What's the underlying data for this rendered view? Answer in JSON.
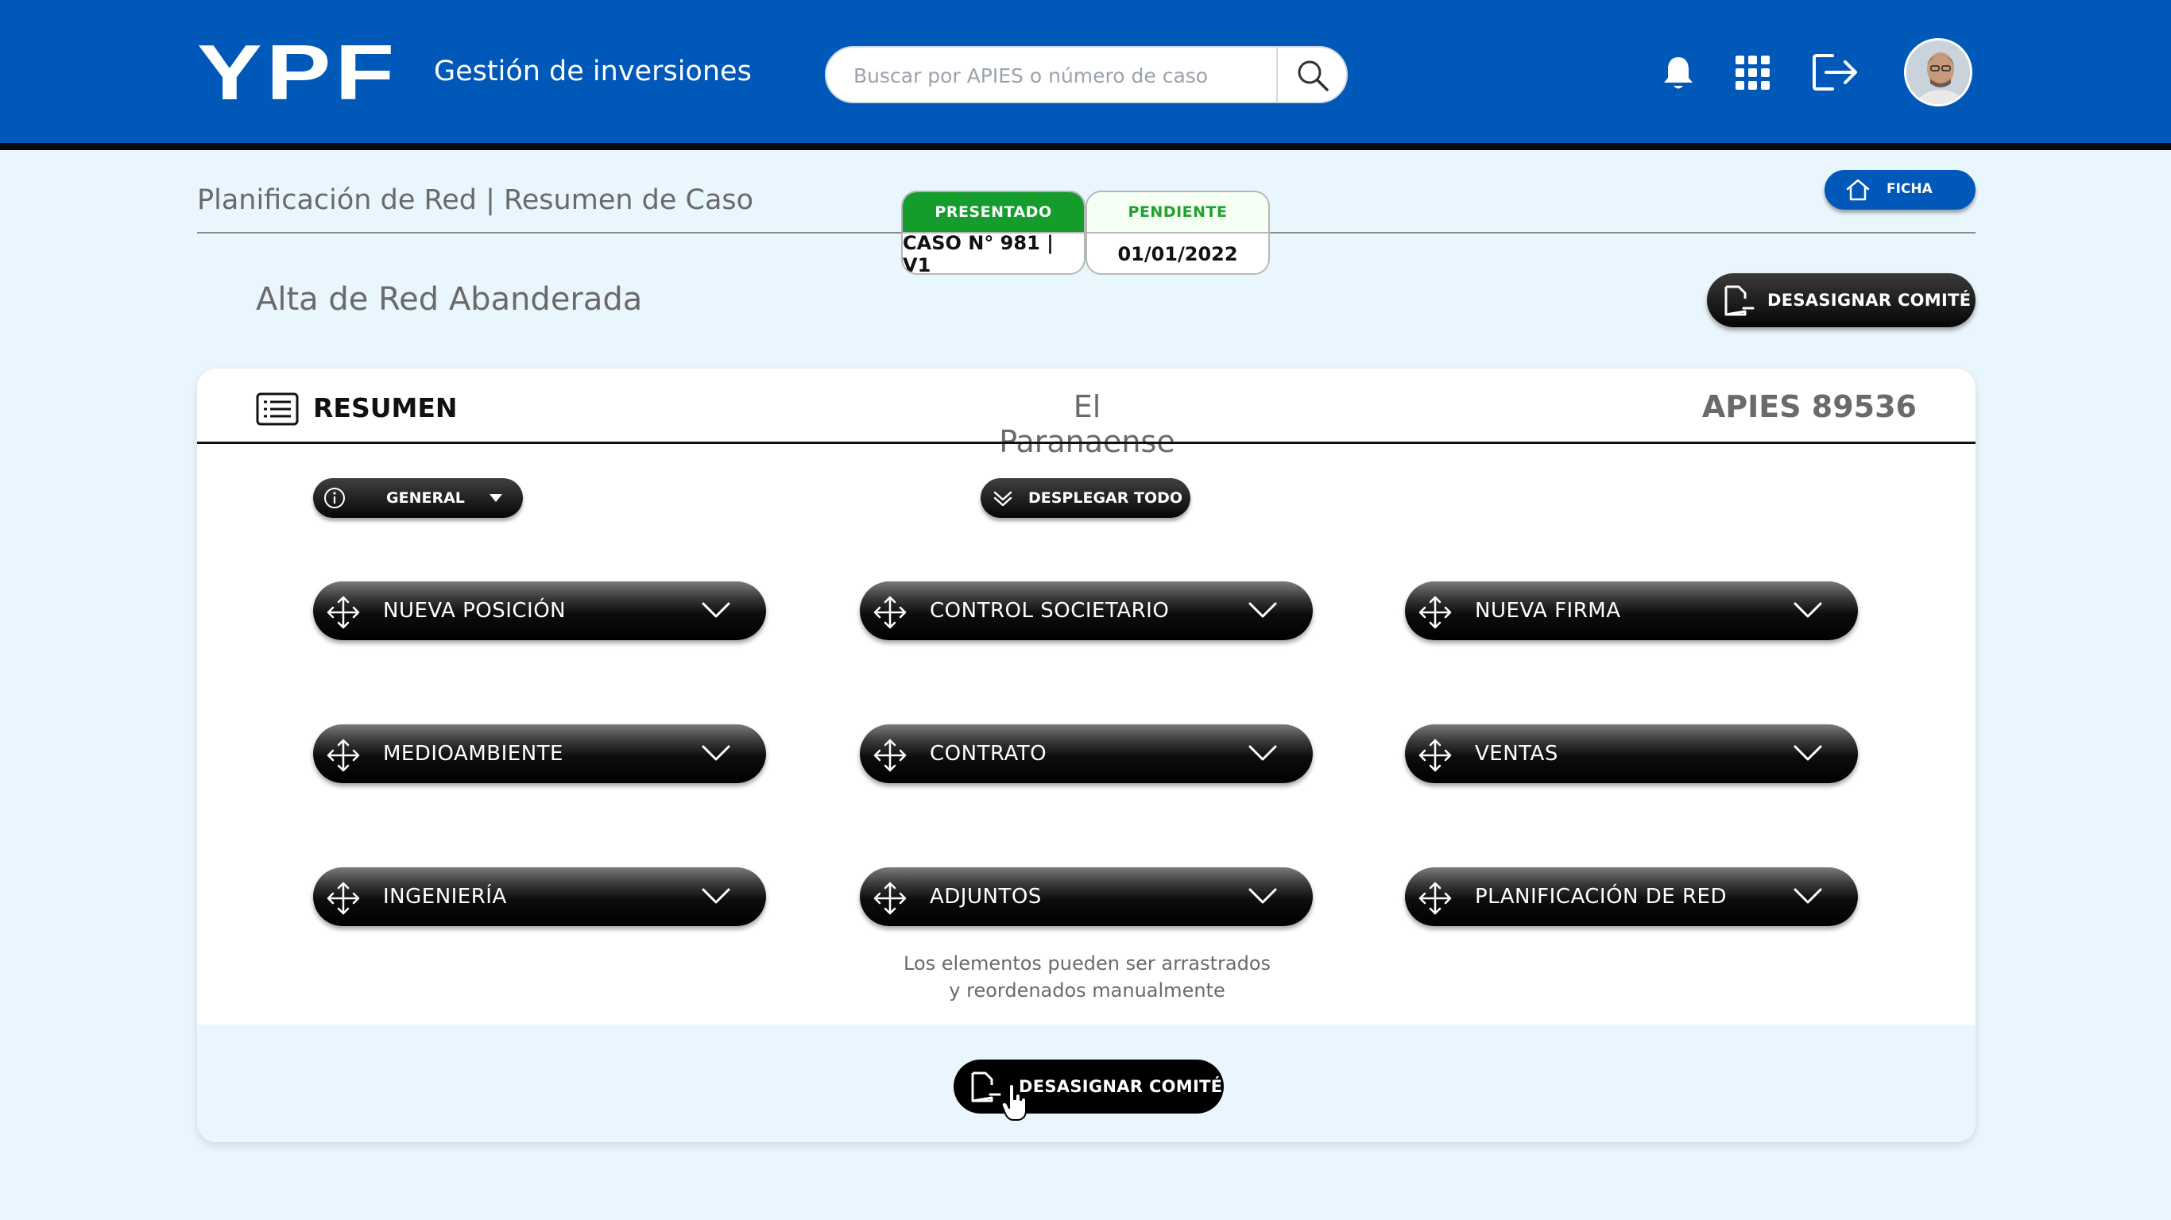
{
  "header": {
    "logo": "YPF",
    "app_title": "Gestión de inversiones",
    "search_placeholder": "Buscar por APIES o número de caso",
    "icons": [
      "bell-icon",
      "apps-grid-icon",
      "logout-icon"
    ]
  },
  "page": {
    "breadcrumb": "Planificación de Red | Resumen de Caso",
    "case_title": "Alta de Red Abanderada",
    "status": [
      {
        "label": "PRESENTADO",
        "value": "CASO N° 981 | V1",
        "color": "#149c2c"
      },
      {
        "label": "PENDIENTE",
        "value": "01/01/2022",
        "color": "#1fa12e"
      }
    ],
    "ficha_label": "FICHA",
    "unassign_label": "DESASIGNAR COMITÉ"
  },
  "summary": {
    "title": "RESUMEN",
    "station": "El Paranaense",
    "apies": "APIES 89536",
    "filter_label": "GENERAL",
    "expand_all_label": "DESPLEGAR TODO",
    "sections": [
      "NUEVA POSICIÓN",
      "CONTROL SOCIETARIO",
      "NUEVA FIRMA",
      "MEDIOAMBIENTE",
      "CONTRATO",
      "VENTAS",
      "INGENIERÍA",
      "ADJUNTOS",
      "PLANIFICACIÓN DE RED"
    ],
    "hint_line1": "Los elementos pueden ser arrastrados",
    "hint_line2": "y reordenados manualmente",
    "unassign_label": "DESASIGNAR COMITÉ"
  },
  "colors": {
    "brand_blue": "#0058b8",
    "status_green": "#149c2c",
    "background": "#eaf6fd"
  }
}
